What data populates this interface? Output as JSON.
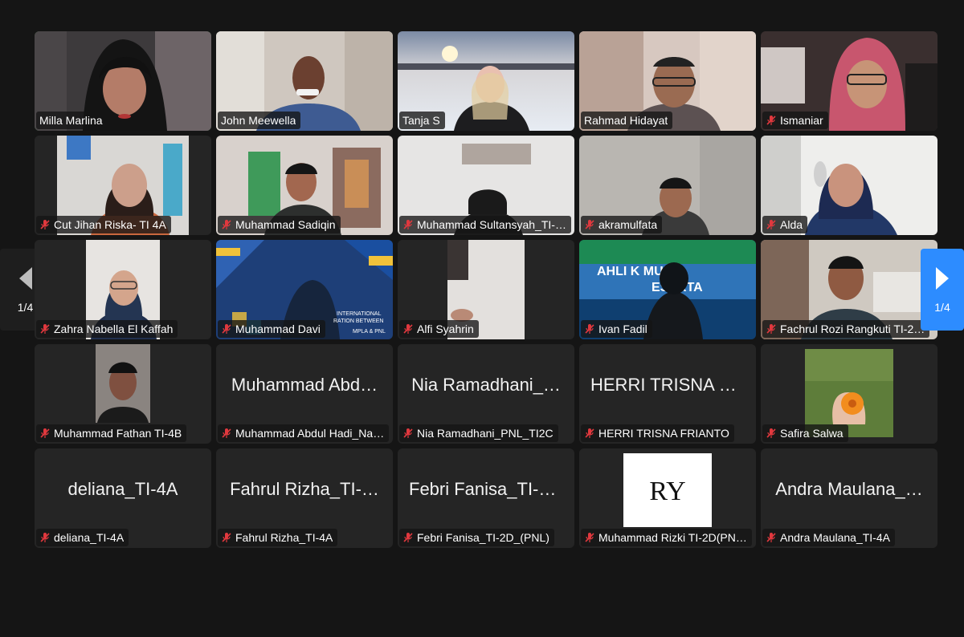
{
  "navigation": {
    "page_left": "1/4",
    "page_right": "1/4",
    "left_arrow_icon": "chevron-left-icon",
    "right_arrow_icon": "chevron-right-icon",
    "accent_color": "#2d8cff"
  },
  "colors": {
    "active_speaker_border": "#4fd05a",
    "muted_icon": "#e0383e",
    "tile_background": "#252525"
  },
  "participants": [
    {
      "name": "Milla Marlina",
      "muted": false,
      "active": true
    },
    {
      "name": "John Meewella",
      "muted": false
    },
    {
      "name": "Tanja S",
      "muted": false
    },
    {
      "name": "Rahmad Hidayat",
      "muted": false
    },
    {
      "name": "Ismaniar",
      "muted": true
    },
    {
      "name": "Cut Jihan Riska- TI 4A",
      "muted": true
    },
    {
      "name": "Muhammad Sadiqin",
      "muted": true
    },
    {
      "name": "Muhammad Sultansyah_TI-…",
      "muted": true
    },
    {
      "name": "akramulfata",
      "muted": true
    },
    {
      "name": "Alda",
      "muted": true
    },
    {
      "name": "Zahra Nabella El Kaffah",
      "muted": true
    },
    {
      "name": "Muhammad Davi",
      "muted": true
    },
    {
      "name": "Alfi Syahrin",
      "muted": true
    },
    {
      "name": "Ivan Fadil",
      "muted": true
    },
    {
      "name": "Fachrul Rozi Rangkuti TI-2…",
      "muted": true
    },
    {
      "name": "Muhammad Fathan TI-4B",
      "muted": true
    },
    {
      "name": "Muhammad Abdul Hadi_Na…",
      "display_name": "Muhammad Abd…",
      "muted": true
    },
    {
      "name": "Nia Ramadhani_PNL_TI2C",
      "display_name": "Nia Ramadhani_…",
      "muted": true
    },
    {
      "name": "HERRI TRISNA FRIANTO",
      "display_name": "HERRI TRISNA F…",
      "muted": true
    },
    {
      "name": "Safira Salwa",
      "muted": true
    },
    {
      "name": "deliana_TI-4A",
      "display_name": "deliana_TI-4A",
      "muted": true
    },
    {
      "name": "Fahrul Rizha_TI-4A",
      "display_name": "Fahrul Rizha_TI-…",
      "muted": true
    },
    {
      "name": "Febri Fanisa_TI-2D_(PNL)",
      "display_name": "Febri Fanisa_TI-2…",
      "muted": true
    },
    {
      "name": "Muhammad Rizki TI-2D(PN…",
      "avatar_text": "RY",
      "muted": true
    },
    {
      "name": "Andra Maulana_TI-4A",
      "display_name": "Andra Maulana_…",
      "muted": true
    }
  ],
  "video_overlays": {
    "davi_banner_line1": "INTERNATIONAL",
    "davi_banner_line2": "RATION BETWEEN",
    "davi_banner_line3": "MPLA & PNL",
    "ivan_banner_line1": "AHLI K    MUM",
    "ivan_banner_line2": "ESERTA"
  }
}
